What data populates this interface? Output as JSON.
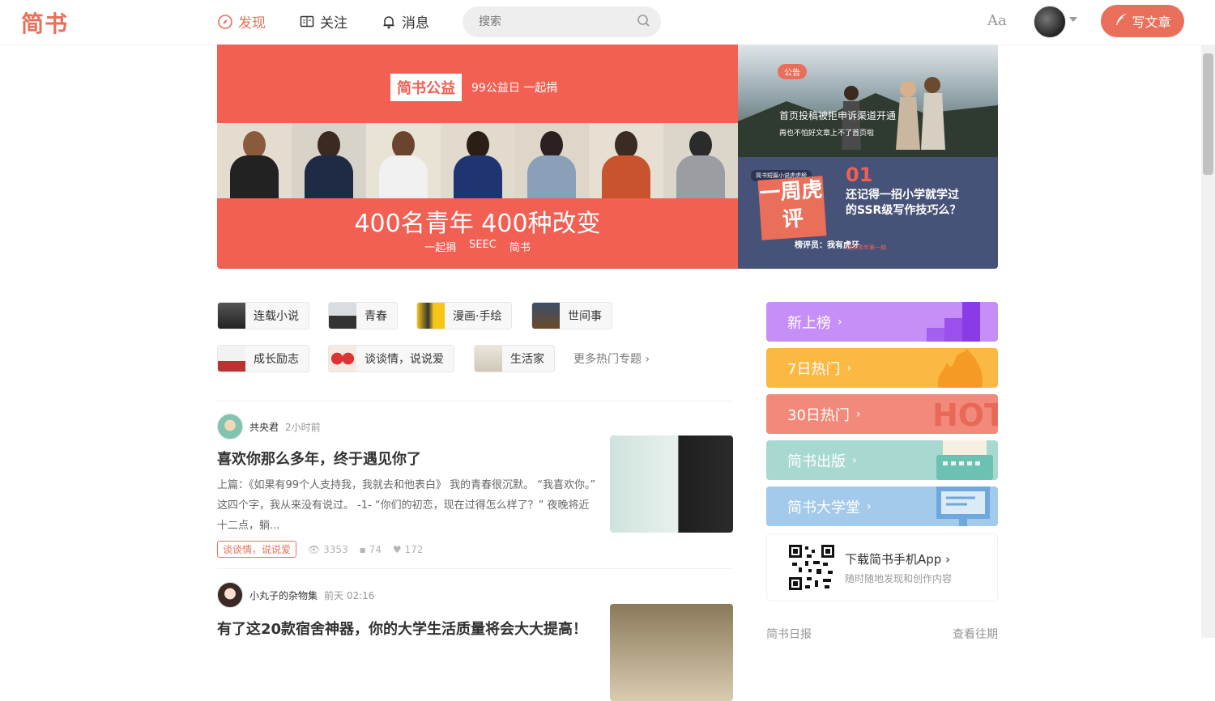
{
  "header": {
    "logo": "简书",
    "nav": [
      {
        "label": "发现",
        "icon": "compass-icon",
        "active": true
      },
      {
        "label": "关注",
        "icon": "book-icon"
      },
      {
        "label": "消息",
        "icon": "bell-icon"
      }
    ],
    "search_placeholder": "搜索",
    "font_toggle": "Aa",
    "write_label": "写文章"
  },
  "banner": {
    "badge": "简书公益",
    "badge_sub": "99公益日 一起捐",
    "headline": "400名青年 400种改变",
    "partners": [
      "一起捐",
      "SEEC",
      "简书"
    ]
  },
  "side_banners": [
    {
      "tag": "公告",
      "title": "首页投稿被拒申诉渠道开通",
      "subtitle": "再也不怕好文章上不了首页啦"
    },
    {
      "badge": "简书短篇小说虎虎榜",
      "title": "一周虎评",
      "number": "01",
      "question": "还记得一招小学就学过的SSR级写作技巧么？",
      "reviewer": "榜评员：我有虎牙",
      "label": "虎评青年第一期"
    }
  ],
  "categories": [
    {
      "label": "连载小说"
    },
    {
      "label": "青春"
    },
    {
      "label": "漫画·手绘"
    },
    {
      "label": "世间事"
    },
    {
      "label": "成长励志"
    },
    {
      "label": "谈谈情，说说爱"
    },
    {
      "label": "生活家"
    }
  ],
  "more_topics": "更多热门专题 ›",
  "articles": [
    {
      "author": "共央君",
      "time": "2小时前",
      "title": "喜欢你那么多年，终于遇见你了",
      "abstract": "上篇：《如果有99个人支持我，我就去和他表白》 我的青春很沉默。 “我喜欢你。” 这四个字，我从来没有说过。 -1- “你们的初恋，现在过得怎么样了？” 夜晚将近十二点，躺...",
      "collection": "谈谈情，说说爱",
      "views": "3353",
      "comments": "74",
      "likes": "172"
    },
    {
      "author": "小丸子的杂物集",
      "time": "前天 02:16",
      "title": "有了这20款宿舍神器，你的大学生活质量将会大大提高！"
    }
  ],
  "boards": [
    {
      "label": "新上榜",
      "color": "#c68ff7"
    },
    {
      "label": "7日热门",
      "color": "#fbb944"
    },
    {
      "label": "30日热门",
      "color": "#f18a7a"
    },
    {
      "label": "简书出版",
      "color": "#a8d9d0"
    },
    {
      "label": "简书大学堂",
      "color": "#a3c9eb"
    }
  ],
  "app_download": {
    "title": "下载简书手机App ›",
    "subtitle": "随时随地发现和创作内容"
  },
  "daily": {
    "left": "简书日报",
    "right": "查看往期"
  }
}
